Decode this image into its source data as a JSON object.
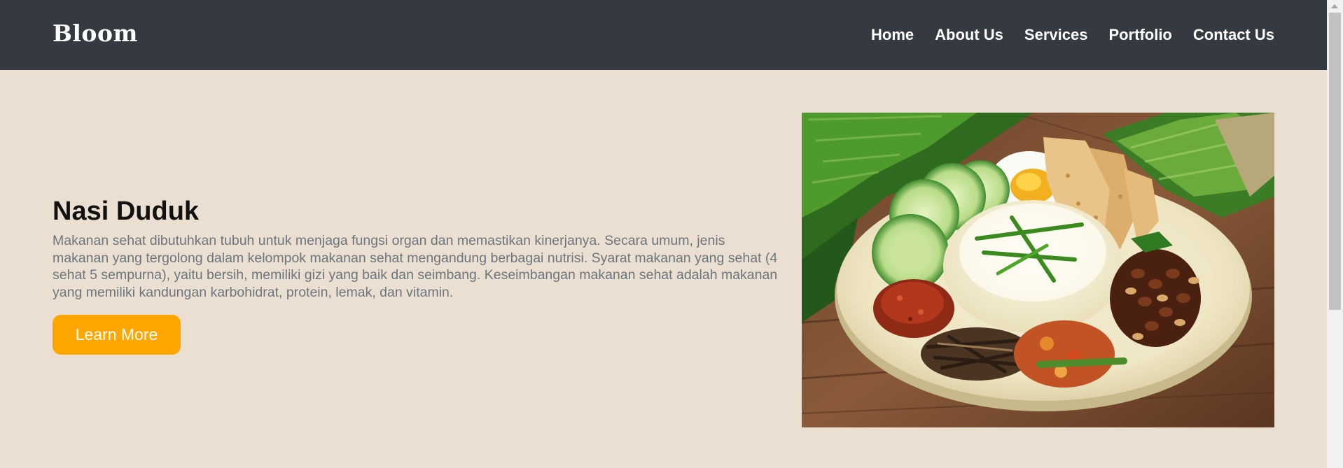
{
  "navbar": {
    "brand": "Bloom",
    "links": [
      "Home",
      "About Us",
      "Services",
      "Portfolio",
      "Contact Us"
    ]
  },
  "hero": {
    "title": "Nasi Duduk",
    "description": "Makanan sehat dibutuhkan tubuh untuk menjaga fungsi organ dan memastikan kinerjanya. Secara umum, jenis makanan yang tergolong dalam kelompok makanan sehat mengandung berbagai nutrisi. Syarat makanan yang sehat (4 sehat 5 sempurna), yaitu bersih, memiliki gizi yang baik dan seimbang. Keseimbangan makanan sehat adalah makanan yang memiliki kandungan karbohidrat, protein, lemak, dan vitamin.",
    "button_label": "Learn More",
    "image_subject": "nasi-uduk-plate-illustration"
  },
  "colors": {
    "navbar_bg": "#343a40",
    "page_bg": "#ebdfd1",
    "button_bg": "#ffa600",
    "description_text": "#6c757d"
  }
}
